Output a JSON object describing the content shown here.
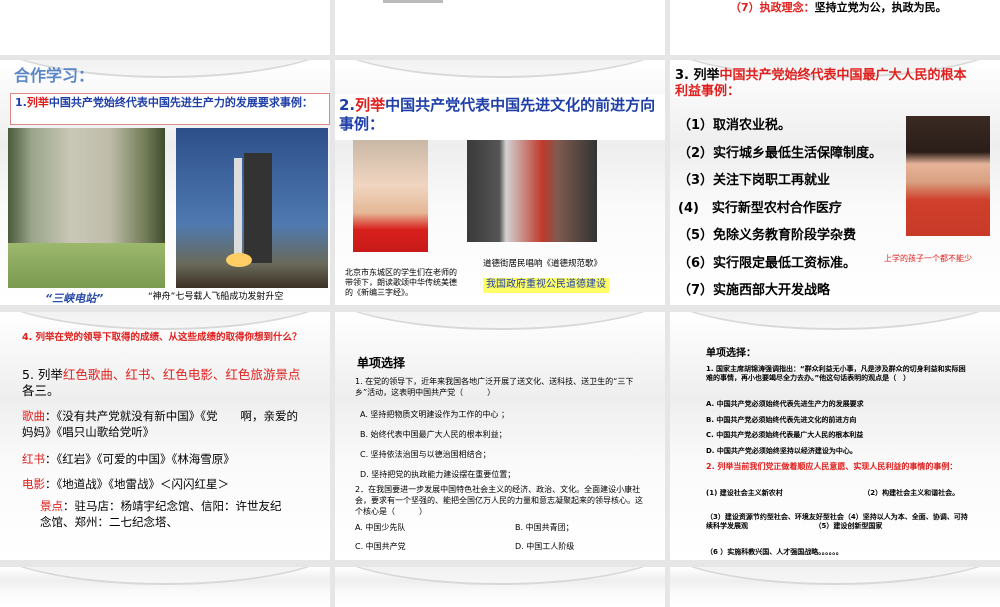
{
  "slides": {
    "top_right": {
      "num": "（7）执政理念：",
      "text": "坚持立党为公，执政为民。"
    },
    "s1": {
      "title": "合作学习：",
      "q_num": "1.",
      "q_red": "列举",
      "q_blue": "中国共产党始终代表中国先进生产力的发展要求事例：",
      "cap1": "“三峡电站”",
      "cap2": "“神舟”七号载人飞船成功发射升空"
    },
    "s2": {
      "q_num": "2.",
      "q_red": "列举",
      "q_blue": "中国共产党代表中国先进文化的前进方向事例：",
      "cap1": "北京市东城区的学生们在老师的带领下，朗读歌颂中华传统美德的《新编三字经》。",
      "cap2": "道德街居民唱响《道德规范歌》",
      "highlight": "我国政府重视公民道德建设",
      "highlight_color": "#ffff66"
    },
    "s3": {
      "q_black": "3. 列举",
      "q_red": "中国共产党始终代表中国最广大人民的根本利益事例：",
      "items": [
        "（1）取消农业税。",
        "（2）实行城乡最低生活保障制度。",
        "（3）关注下岗职工再就业",
        "(4)　实行新型农村合作医疗",
        "（5）免除义务教育阶段学杂费",
        "（6）实行限定最低工资标准。",
        "（7）实施西部大开发战略"
      ],
      "photo_caption": "上学的孩子一个都不能少"
    },
    "s4": {
      "q4": "4. 列举在党的领导下取得的成绩、从这些成绩的取得你想到什么？",
      "q5_black": "5. 列举",
      "q5_red": "红色歌曲、红书、红色电影、红色旅游景点",
      "q5_end": "各三。",
      "songs_label": "歌曲",
      "songs": "：《没有共产党就没有新中国》《党　　啊，亲爱的妈妈》《唱只山歌给党听》",
      "books_label": "红书",
      "books": "：《红岩》《可爱的中国》《林海雪原》",
      "films_label": "电影",
      "films": "：《地道战》《地雷战》＜闪闪红星＞",
      "sites_label": "景点",
      "sites": "：驻马店：杨靖宇纪念馆、信阳：许世友纪　　　念馆、郑州：二七纪念塔、"
    },
    "s5": {
      "title": "单项选择",
      "q1": "1. 在党的领导下，近年来我国各地广泛开展了送文化、送科技、送卫生的“三下乡”活动，这表明中国共产党（　　　）",
      "q1_opts": [
        "A. 坚持把物质文明建设作为工作的中心 ；",
        "B. 始终代表中国最广大人民的根本利益；",
        "C. 坚持依法治国与以德治国相结合；",
        "D. 坚持把党的执政能力建设摆在重要位置；"
      ],
      "q2": "2．在我国要进一步发展中国特色社会主义的经济、政治、文化。全面建设小康社会，要求有一个坚强的、能把全国亿万人民的力量和意志凝聚起来的领导核心。这个核心是（　　　）",
      "q2_opts": [
        "A. 中国少先队",
        "B. 中国共青团；",
        "C. 中国共产党",
        "D. 中国工人阶级"
      ]
    },
    "s6": {
      "title": "单项选择：",
      "q1": "1. 国家主席胡锦涛强调指出：“群众利益无小事，凡是涉及群众的切身利益和实际困难的事情，再小也要竭尽全力去办。”他这句话表明的观点是（　）",
      "q1_opts": [
        "A. 中国共产党必须始终代表先进生产力的发展要求",
        "B. 中国共产党必须始终代表先进文化的前进方向",
        "C. 中国共产党必须始终代表最广大人民的根本利益",
        "D. 中国共产党必须始终坚持以经济建设为中心。"
      ],
      "q2": "2. 列举当前我们党正做着顺应人民意愿、实现人民利益的事情的事例：",
      "a1": "(1) 建设社会主义新农村　　　　　　　　　　　　（2）构建社会主义和谐社会。",
      "a2": "（3）建设资源节约型社会、环境友好型社会（4）坚持以人为本、全面、协调、可持续科学发展观　　　　　　　　　　（5）建设创新型国家",
      "a3": "（6 ）实施科教兴国、人才强国战略。。。。。。"
    }
  }
}
